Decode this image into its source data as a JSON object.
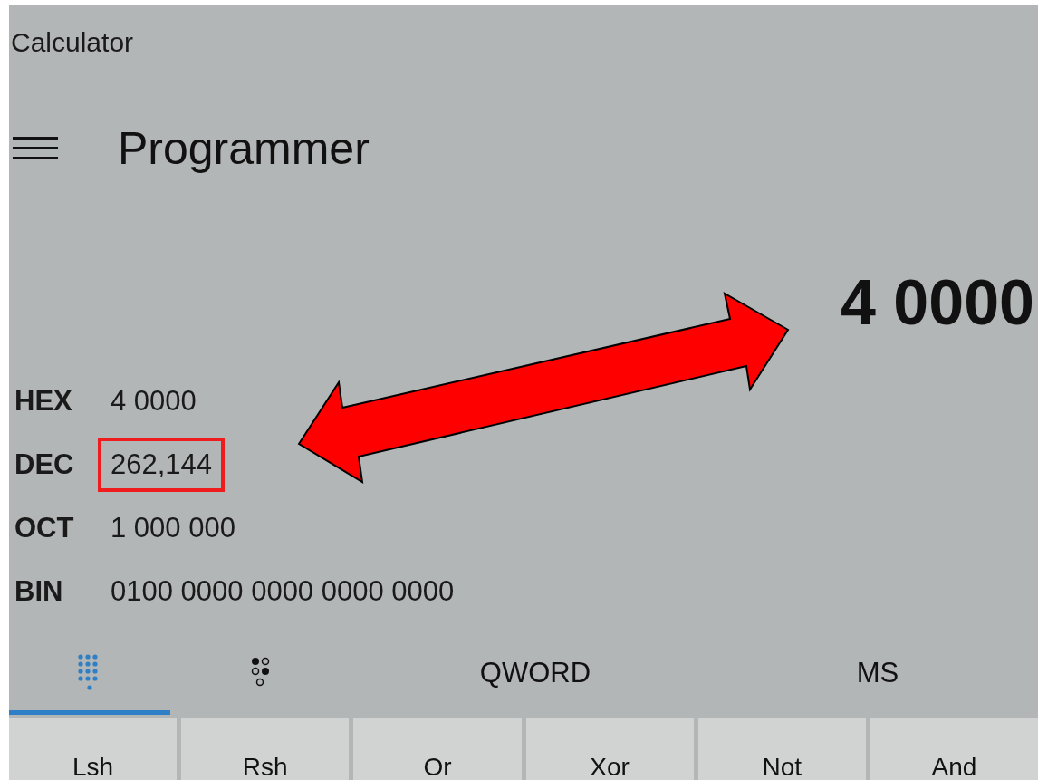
{
  "window": {
    "title": "Calculator"
  },
  "header": {
    "mode": "Programmer"
  },
  "display": {
    "value": "4 0000"
  },
  "radix_rows": [
    {
      "label": "HEX",
      "value": "4 0000",
      "highlighted": false
    },
    {
      "label": "DEC",
      "value": "262,144",
      "highlighted": true
    },
    {
      "label": "OCT",
      "value": "1 000 000",
      "highlighted": false
    },
    {
      "label": "BIN",
      "value": "0100 0000 0000 0000 0000",
      "highlighted": false
    }
  ],
  "tabs": [
    {
      "kind": "keypad",
      "selected": true
    },
    {
      "kind": "bits",
      "selected": false
    },
    {
      "kind": "text",
      "label": "QWORD",
      "selected": false
    },
    {
      "kind": "text",
      "label": "MS",
      "selected": false
    }
  ],
  "keys": [
    "Lsh",
    "Rsh",
    "Or",
    "Xor",
    "Not",
    "And"
  ]
}
